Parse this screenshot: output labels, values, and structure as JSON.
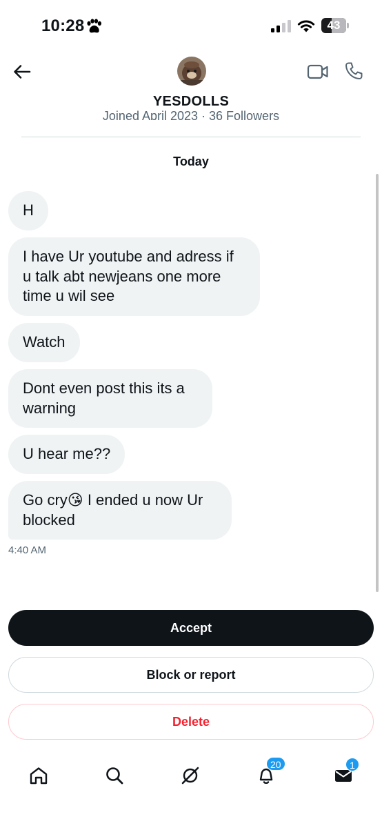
{
  "status_bar": {
    "time": "10:28",
    "battery": "43",
    "battery_level_pct": 43
  },
  "header": {
    "name": "YESDOLLS",
    "profile_subtitle": "Joined April 2023 · 36 Followers"
  },
  "conversation": {
    "day_label": "Today",
    "messages": [
      {
        "text": "H"
      },
      {
        "text": "I have Ur youtube and adress if u talk abt newjeans one more time u wil see"
      },
      {
        "text": "Watch"
      },
      {
        "text": "Dont even post this its a warning"
      },
      {
        "text": "U hear me??"
      },
      {
        "text": "Go cry😘 I ended u now Ur blocked"
      }
    ],
    "timestamp": "4:40 AM"
  },
  "actions": {
    "accept": "Accept",
    "block_report": "Block or report",
    "delete": "Delete"
  },
  "tab_bar": {
    "notifications_badge": "20",
    "messages_badge": "1"
  },
  "colors": {
    "accent": "#1d9bf0",
    "bubble": "#eff3f4",
    "primary_button": "#0f1419",
    "danger": "#f4212e"
  }
}
